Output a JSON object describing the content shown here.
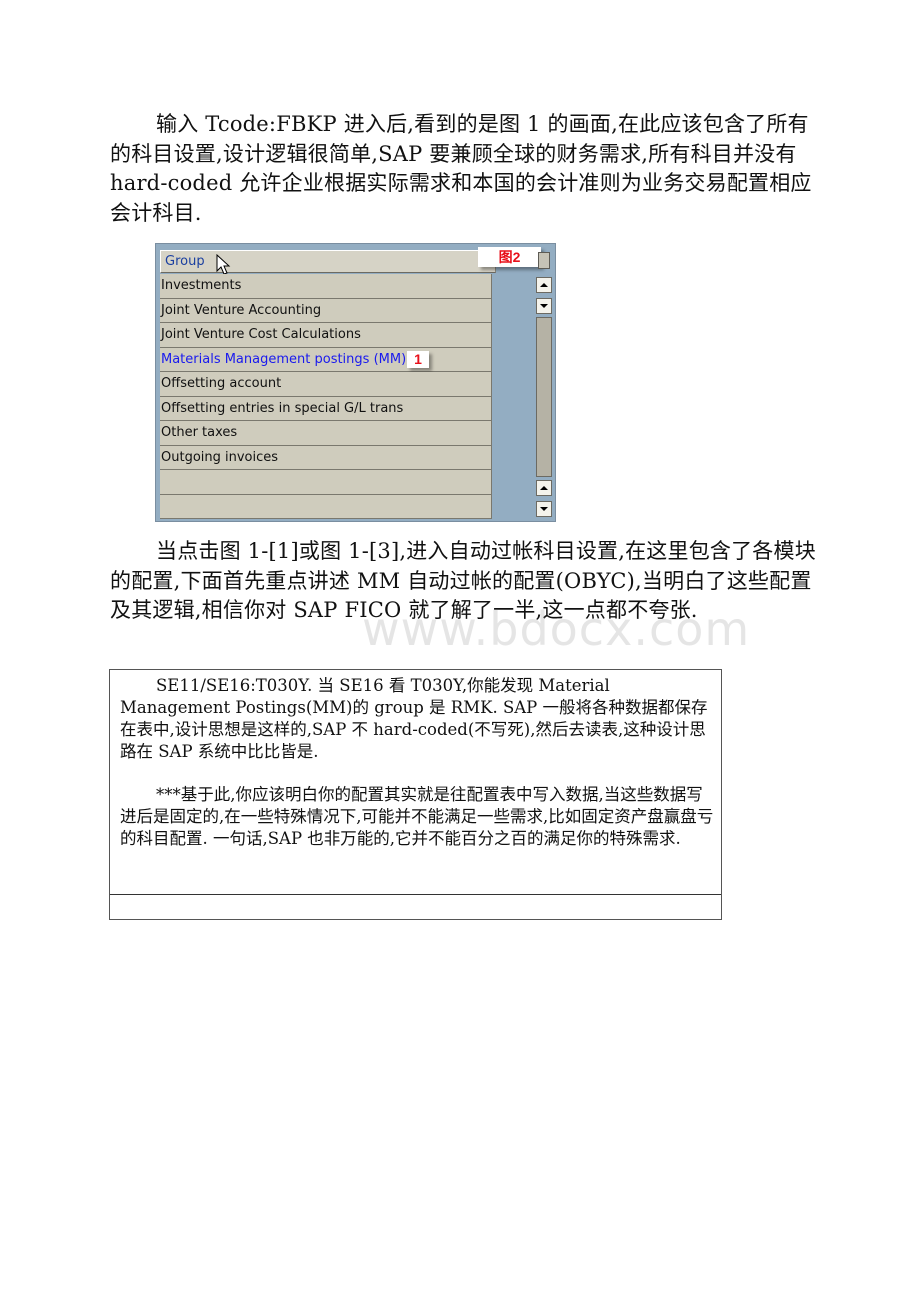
{
  "paragraphs": {
    "intro": "输入 Tcode:FBKP 进入后,看到的是图 1 的画面,在此应该包含了所有的科目设置,设计逻辑很简单,SAP 要兼顾全球的财务需求,所有科目并没有 hard-coded 允许企业根据实际需求和本国的会计准则为业务交易配置相应会计科目.",
    "followup": "当点击图 1-[1]或图 1-[3],进入自动过帐科目设置,在这里包含了各模块的配置,下面首先重点讲述 MM 自动过帐的配置(OBYC),当明白了这些配置及其逻辑,相信你对 SAP FICO 就了解了一半,这一点都不夸张."
  },
  "sap_screenshot": {
    "column_header": "Group",
    "figure_label": "图2",
    "selected_marker": "1",
    "rows": [
      {
        "label": "Investments",
        "active": false
      },
      {
        "label": "Joint Venture Accounting",
        "active": false
      },
      {
        "label": "Joint Venture Cost Calculations",
        "active": false
      },
      {
        "label": "Materials Management postings (MM)",
        "active": true
      },
      {
        "label": "Offsetting account",
        "active": false
      },
      {
        "label": "Offsetting entries in special G/L trans",
        "active": false
      },
      {
        "label": "Other taxes",
        "active": false
      },
      {
        "label": "Outgoing invoices",
        "active": false
      },
      {
        "label": "",
        "active": false
      },
      {
        "label": "",
        "active": false
      }
    ],
    "colors": {
      "panel_bg": "#93adc2",
      "row_bg": "#cfccbd",
      "active_text": "#1a1aee",
      "header_text": "#1a3fa0",
      "marker": "#e8101a"
    }
  },
  "note_box": {
    "paragraph1": "SE11/SE16:T030Y. 当 SE16 看 T030Y,你能发现 Material Management Postings(MM)的 group 是 RMK. SAP 一般将各种数据都保存在表中,设计思想是这样的,SAP 不 hard-coded(不写死),然后去读表,这种设计思路在 SAP 系统中比比皆是.",
    "paragraph2": "***基于此,你应该明白你的配置其实就是往配置表中写入数据,当这些数据写进后是固定的,在一些特殊情况下,可能并不能满足一些需求,比如固定资产盘赢盘亏的科目配置. 一句话,SAP 也非万能的,它并不能百分之百的满足你的特殊需求."
  },
  "watermark": "www.bdocx.com"
}
